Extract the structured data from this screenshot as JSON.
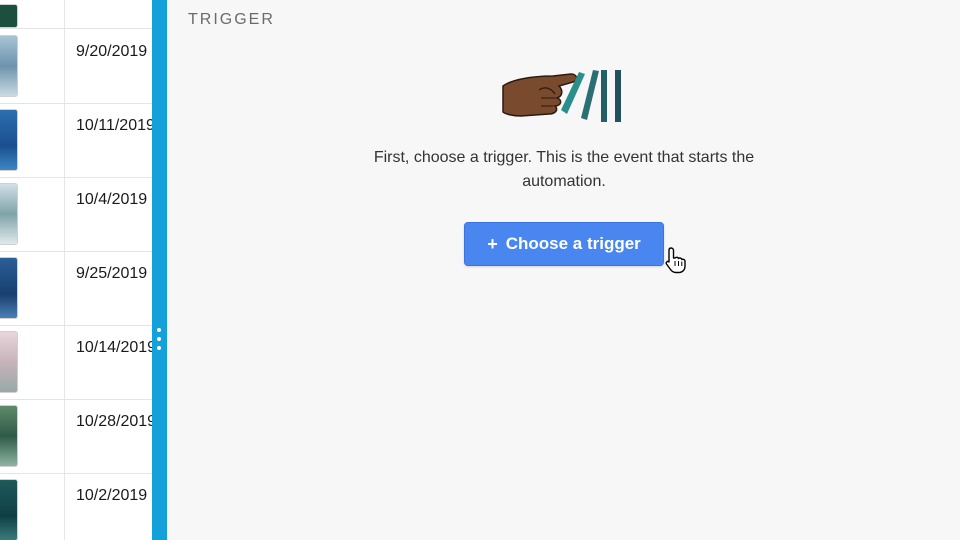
{
  "grid": {
    "rows": [
      {
        "date": ""
      },
      {
        "date": "9/20/2019"
      },
      {
        "date": "10/11/2019"
      },
      {
        "date": "10/4/2019"
      },
      {
        "date": "9/25/2019"
      },
      {
        "date": "10/14/2019"
      },
      {
        "date": "10/28/2019"
      },
      {
        "date": "10/2/2019"
      }
    ]
  },
  "panel": {
    "section_title": "TRIGGER",
    "description": "First, choose a trigger. This is the event that starts the automation.",
    "button_icon": "+",
    "button_label": "Choose a trigger"
  },
  "colors": {
    "splitter": "#14a1da",
    "button": "#4a86f0",
    "domino": "#2a6f73"
  },
  "icons": [
    "hand-domino-illustration",
    "pointer-hand-cursor",
    "drag-handle-icon"
  ]
}
